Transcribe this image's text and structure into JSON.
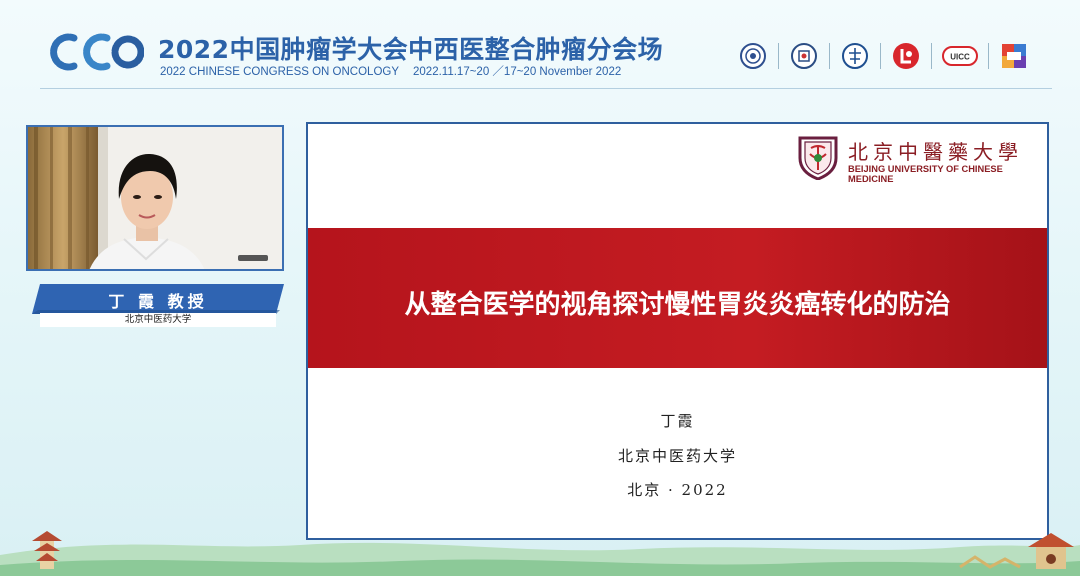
{
  "header": {
    "title": "2022中国肿瘤学大会中西医整合肿瘤分会场",
    "subtitle": "2022 CHINESE CONGRESS ON ONCOLOGY",
    "date_text": "2022.11.17~20 ／17~20 November 2022",
    "logo_icon": "cco-logo-icon",
    "sponsor_icons": [
      "seal-icon-1",
      "seal-icon-2",
      "seal-icon-3",
      "red-circle-icon",
      "uicc-icon",
      "cacc-icon"
    ],
    "sponsor_badge": "UICC"
  },
  "speaker": {
    "name": "丁 霞  教授",
    "affiliation": "北京中医药大学"
  },
  "slide": {
    "university_cn": "北京中醫藥大學",
    "university_en": "BEIJING UNIVERSITY OF CHINESE MEDICINE",
    "title": "从整合医学的视角探讨慢性胃炎炎癌转化的防治",
    "author": "丁霞",
    "institution": "北京中医药大学",
    "place_year": "北京 · 2022"
  },
  "colors": {
    "brand_blue": "#2c62a8",
    "slide_red": "#c41c22",
    "uni_red": "#8b1e24"
  }
}
